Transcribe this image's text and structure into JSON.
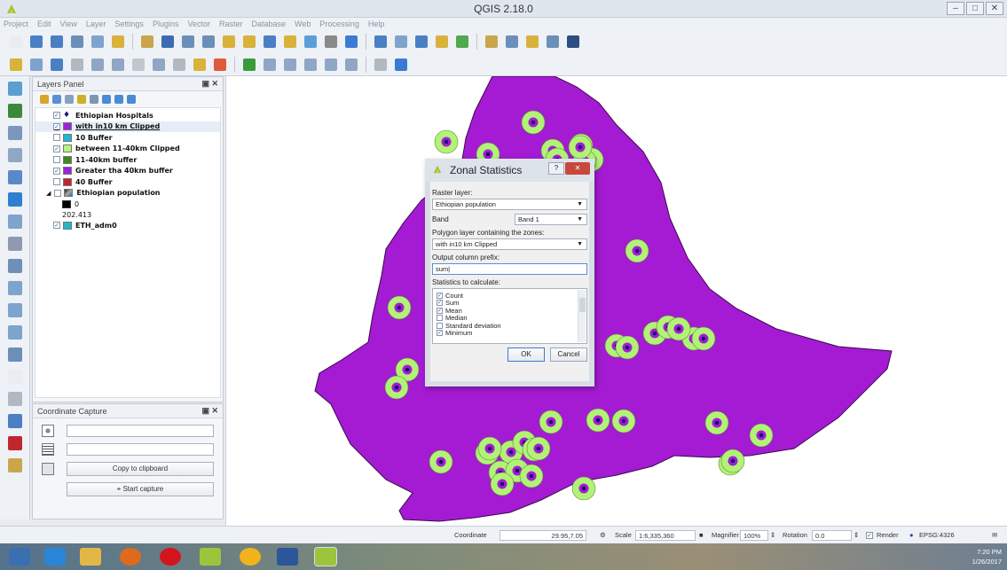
{
  "window": {
    "title": "QGIS 2.18.0"
  },
  "menu": [
    "Project",
    "Edit",
    "View",
    "Layer",
    "Settings",
    "Plugins",
    "Vector",
    "Raster",
    "Database",
    "Web",
    "Processing",
    "Help"
  ],
  "layers_panel": {
    "title": "Layers Panel",
    "layers": [
      {
        "name": "Ethiopian Hospitals",
        "checked": true,
        "symbol": "point",
        "color": "#1a1a7a"
      },
      {
        "name": "with in10 km Clipped",
        "checked": true,
        "symbol": "fill",
        "color": "#a020e0",
        "selected": true
      },
      {
        "name": "10 Buffer",
        "checked": false,
        "symbol": "fill",
        "color": "#1fb8d4"
      },
      {
        "name": "between 11-40km Clipped",
        "checked": true,
        "symbol": "fill",
        "color": "#b6f27a"
      },
      {
        "name": "11-40km buffer",
        "checked": false,
        "symbol": "fill",
        "color": "#3d8a1f"
      },
      {
        "name": "Greater tha 40km buffer",
        "checked": true,
        "symbol": "fill",
        "color": "#a020e0"
      },
      {
        "name": "40 Buffer",
        "checked": false,
        "symbol": "fill",
        "color": "#c2262d"
      },
      {
        "name": "Ethiopian population",
        "checked": false,
        "symbol": "raster",
        "color": "#444444"
      }
    ],
    "raster_legend": [
      {
        "label": "0",
        "color": "#000000"
      },
      {
        "label": "202.413",
        "color": "#ffffff"
      }
    ],
    "last_layer": {
      "name": "ETH_adm0",
      "checked": true,
      "color": "#1fb8c4"
    }
  },
  "coordinate_capture": {
    "title": "Coordinate Capture",
    "copy_label": "Copy to clipboard",
    "start_label": "Start capture"
  },
  "dialog": {
    "title": "Zonal Statistics",
    "raster_layer_label": "Raster layer:",
    "raster_layer_value": "Ethiopian population",
    "band_label": "Band",
    "band_value": "Band 1",
    "polygon_label": "Polygon layer containing the zones:",
    "polygon_value": "with in10 km Clipped",
    "prefix_label": "Output column prefix:",
    "prefix_value": "sum",
    "stats_label": "Statistics to calculate:",
    "stats": [
      {
        "label": "Count",
        "checked": true
      },
      {
        "label": "Sum",
        "checked": true
      },
      {
        "label": "Mean",
        "checked": true
      },
      {
        "label": "Median",
        "checked": false
      },
      {
        "label": "Standard deviation",
        "checked": false
      },
      {
        "label": "Minimum",
        "checked": true
      }
    ],
    "ok_label": "OK",
    "cancel_label": "Cancel"
  },
  "statusbar": {
    "coordinate_label": "Coordinate",
    "coordinate_value": "29.95,7.05",
    "scale_label": "Scale",
    "scale_value": "1:6,335,360",
    "magnifier_label": "Magnifier",
    "magnifier_value": "100%",
    "rotation_label": "Rotation",
    "rotation_value": "0.0",
    "render_label": "Render",
    "crs": "EPSG:4326"
  },
  "taskbar": {
    "time": "7:20 PM",
    "date": "1/26/2017"
  },
  "colors": {
    "country_fill": "#a41bd3",
    "buffer_fill": "#b2f277",
    "hospital_dot": "#101070"
  }
}
